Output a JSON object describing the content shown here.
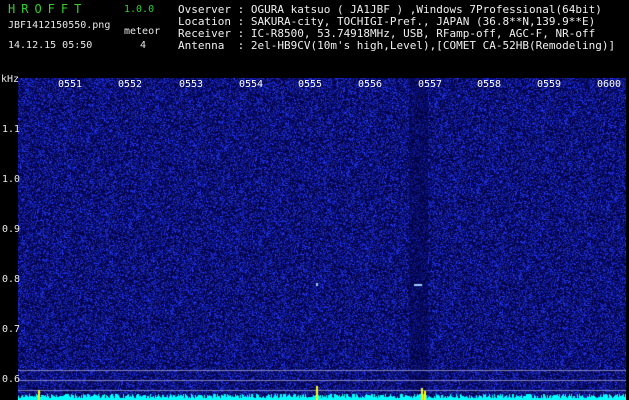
{
  "app": {
    "title": "HROFFT",
    "version": "1.0.0",
    "file_name": "JBF1412150550.png",
    "timestamp": "14.12.15 05:50",
    "meteor_label": "meteor",
    "meteor_count": "4"
  },
  "info": {
    "observer": "Ovserver : OGURA katsuo ( JA1JBF ) ,Windows 7Professional(64bit)",
    "location": "Location : SAKURA-city, TOCHIGI-Pref., JAPAN (36.8**N,139.9**E)",
    "receiver": "Receiver : IC-R8500, 53.74918MHz, USB, RFamp-off, AGC-F, NR-off",
    "antenna": "Antenna  : 2el-HB9CV(10m's high,Level),[COMET CA-52HB(Remodeling)]"
  },
  "spectrogram": {
    "y_unit": "kHz",
    "time_labels": [
      "0551",
      "0552",
      "0553",
      "0554",
      "0555",
      "0556",
      "0557",
      "0558",
      "0559",
      "0600"
    ],
    "freq_labels": [
      "1.1",
      "1.0",
      "0.9",
      "0.8",
      "0.7",
      "0.6"
    ],
    "colors": {
      "background": "#000066",
      "noise": "#1a1aff",
      "label_green": "#2fd02f",
      "baseline_cyan": "#00ffff",
      "signal_yellow": "#ffff00"
    }
  }
}
